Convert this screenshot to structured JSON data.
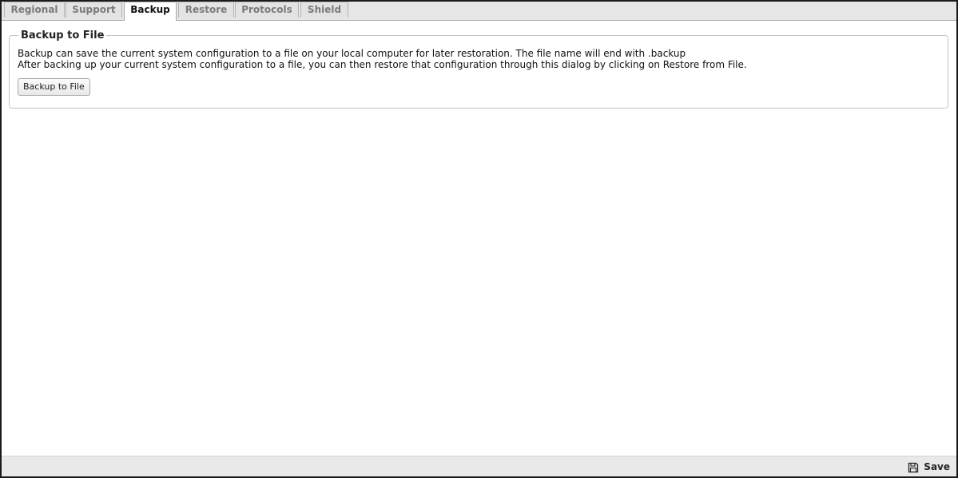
{
  "tabs": [
    {
      "label": "Regional",
      "active": false
    },
    {
      "label": "Support",
      "active": false
    },
    {
      "label": "Backup",
      "active": true
    },
    {
      "label": "Restore",
      "active": false
    },
    {
      "label": "Protocols",
      "active": false
    },
    {
      "label": "Shield",
      "active": false
    }
  ],
  "backup_panel": {
    "legend": "Backup to File",
    "line1": "Backup can save the current system configuration to a file on your local computer for later restoration. The file name will end with .backup",
    "line2": "After backing up your current system configuration to a file, you can then restore that configuration through this dialog by clicking on Restore from File.",
    "button_label": "Backup to File"
  },
  "footer": {
    "save_label": "Save",
    "save_icon": "floppy-disk-icon"
  }
}
